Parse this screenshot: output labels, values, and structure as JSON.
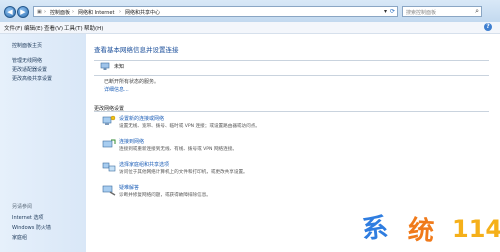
{
  "titlebar": {
    "back_icon": "back-arrow-icon",
    "forward_icon": "forward-arrow-icon",
    "breadcrumb": [
      "控制面板",
      "网络和 Internet",
      "网络和共享中心"
    ],
    "search_placeholder": "搜索控制面板"
  },
  "menu": [
    "文件(F)",
    "编辑(E)",
    "查看(V)",
    "工具(T)",
    "帮助(H)"
  ],
  "sidebar": {
    "home": "控制面板主页",
    "items": [
      "管理无线网络",
      "更改适配器设置",
      "更改高级共享设置"
    ],
    "see_also_title": "另请参阅",
    "see_also": [
      "Internet 选项",
      "Windows 防火墙",
      "家庭组"
    ]
  },
  "main": {
    "title": "查看基本网络信息并设置连接",
    "network_name": "未知",
    "disconnected_text": "已断开所有状态的服务。",
    "details_link": "详细信息...",
    "settings_heading": "更改网络设置",
    "tasks": [
      {
        "label": "设置新的连接或网络",
        "desc": "设置无线、宽带、拨号、临时或 VPN 连接；或设置路由器或访问点。"
      },
      {
        "label": "连接到网络",
        "desc": "连接到或重新连接到无线、有线、拨号或 VPN 网络连接。"
      },
      {
        "label": "选择家庭组和共享选项",
        "desc": "访问位于其他网络计算机上的文件和打印机，或更改共享设置。"
      },
      {
        "label": "疑难解答",
        "desc": "诊断并修复网络问题，或获得故障排除信息。"
      }
    ]
  },
  "watermark": {
    "chars": [
      "系",
      "统",
      "114"
    ],
    "colors": [
      "#2f7de0",
      "#f07a1a",
      "#f5b01a"
    ]
  }
}
